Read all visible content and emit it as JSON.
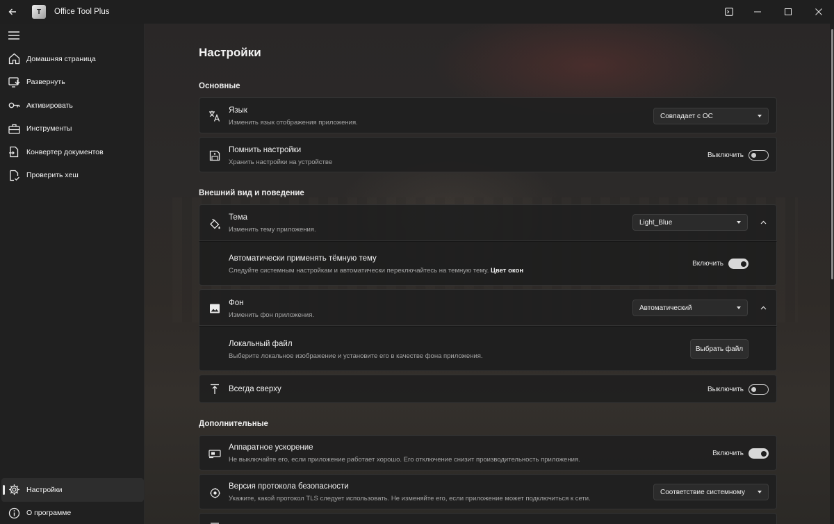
{
  "window": {
    "title": "Office Tool Plus",
    "logo_text": "T"
  },
  "sidebar": {
    "items": [
      {
        "label": "Домашняя страница",
        "icon": "home-icon"
      },
      {
        "label": "Развернуть",
        "icon": "deploy-icon"
      },
      {
        "label": "Активировать",
        "icon": "key-icon"
      },
      {
        "label": "Инструменты",
        "icon": "toolbox-icon"
      },
      {
        "label": "Конвертер документов",
        "icon": "convert-document-icon"
      },
      {
        "label": "Проверить хеш",
        "icon": "check-document-icon"
      }
    ],
    "bottom": [
      {
        "label": "Настройки",
        "icon": "gear-icon",
        "active": true
      },
      {
        "label": "О программе",
        "icon": "info-icon"
      }
    ]
  },
  "page": {
    "title": "Настройки"
  },
  "sections": {
    "basic": "Основные",
    "appearance": "Внешний вид и поведение",
    "advanced": "Дополнительные"
  },
  "settings": {
    "language": {
      "title": "Язык",
      "desc": "Изменить язык отображения приложения.",
      "value": "Совпадает с ОС"
    },
    "remember": {
      "title": "Помнить настройки",
      "desc": "Хранить настройки на устройстве",
      "toggle_label": "Выключить",
      "on": false
    },
    "theme": {
      "title": "Тема",
      "desc": "Изменить тему приложения.",
      "value": "Light_Blue"
    },
    "auto_dark": {
      "title": "Автоматически применять тёмную тему",
      "desc": "Следуйте системным настройкам и автоматически переключайтесь на темную тему.",
      "link": "Цвет окон",
      "toggle_label": "Включить",
      "on": true
    },
    "background": {
      "title": "Фон",
      "desc": "Изменить фон приложения.",
      "value": "Автоматический"
    },
    "local_file": {
      "title": "Локальный файл",
      "desc": "Выберите локальное изображение и установите его в качестве фона приложения.",
      "button": "Выбрать файл"
    },
    "always_on_top": {
      "title": "Всегда сверху",
      "toggle_label": "Выключить",
      "on": false
    },
    "hw_accel": {
      "title": "Аппаратное ускорение",
      "desc": "Не выключайте его, если приложение работает хорошо. Его отключение снизит производительность приложения.",
      "toggle_label": "Включить",
      "on": true
    },
    "tls": {
      "title": "Версия протокола безопасности",
      "desc": "Укажите, какой протокол TLS следует использовать. Не изменяйте его, если приложение может подключиться к сети.",
      "value": "Соответствие системному"
    }
  }
}
